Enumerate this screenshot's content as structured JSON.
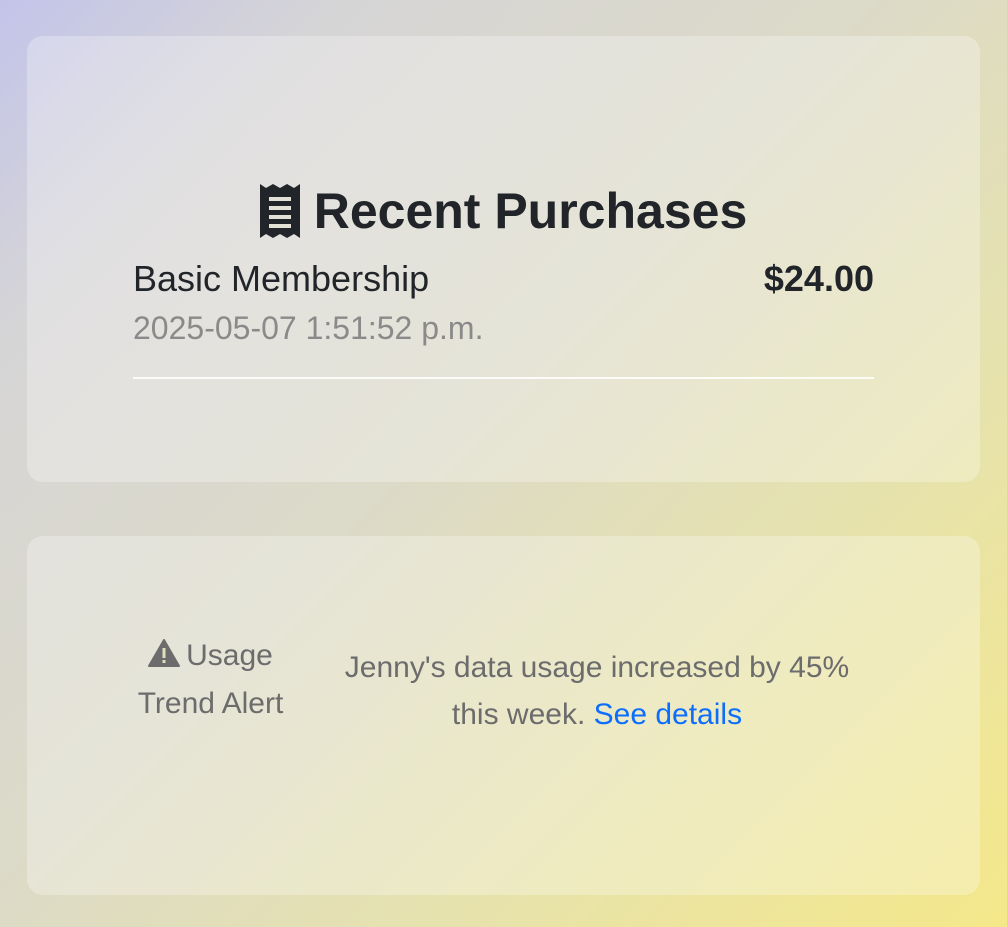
{
  "purchases": {
    "title": "Recent Purchases",
    "icon": "receipt-icon",
    "items": [
      {
        "name": "Basic Membership",
        "date": "2025-05-07 1:51:52 p.m.",
        "price": "$24.00"
      }
    ]
  },
  "alert": {
    "icon": "warning-icon",
    "label": "Usage Trend Alert",
    "message": "Jenny's data usage increased by 45% this week.",
    "link_text": "See details"
  },
  "colors": {
    "text_dark": "#212529",
    "text_muted": "#6c6c6c",
    "date_gray": "#8a8a8a",
    "link_blue": "#0d6efd"
  }
}
